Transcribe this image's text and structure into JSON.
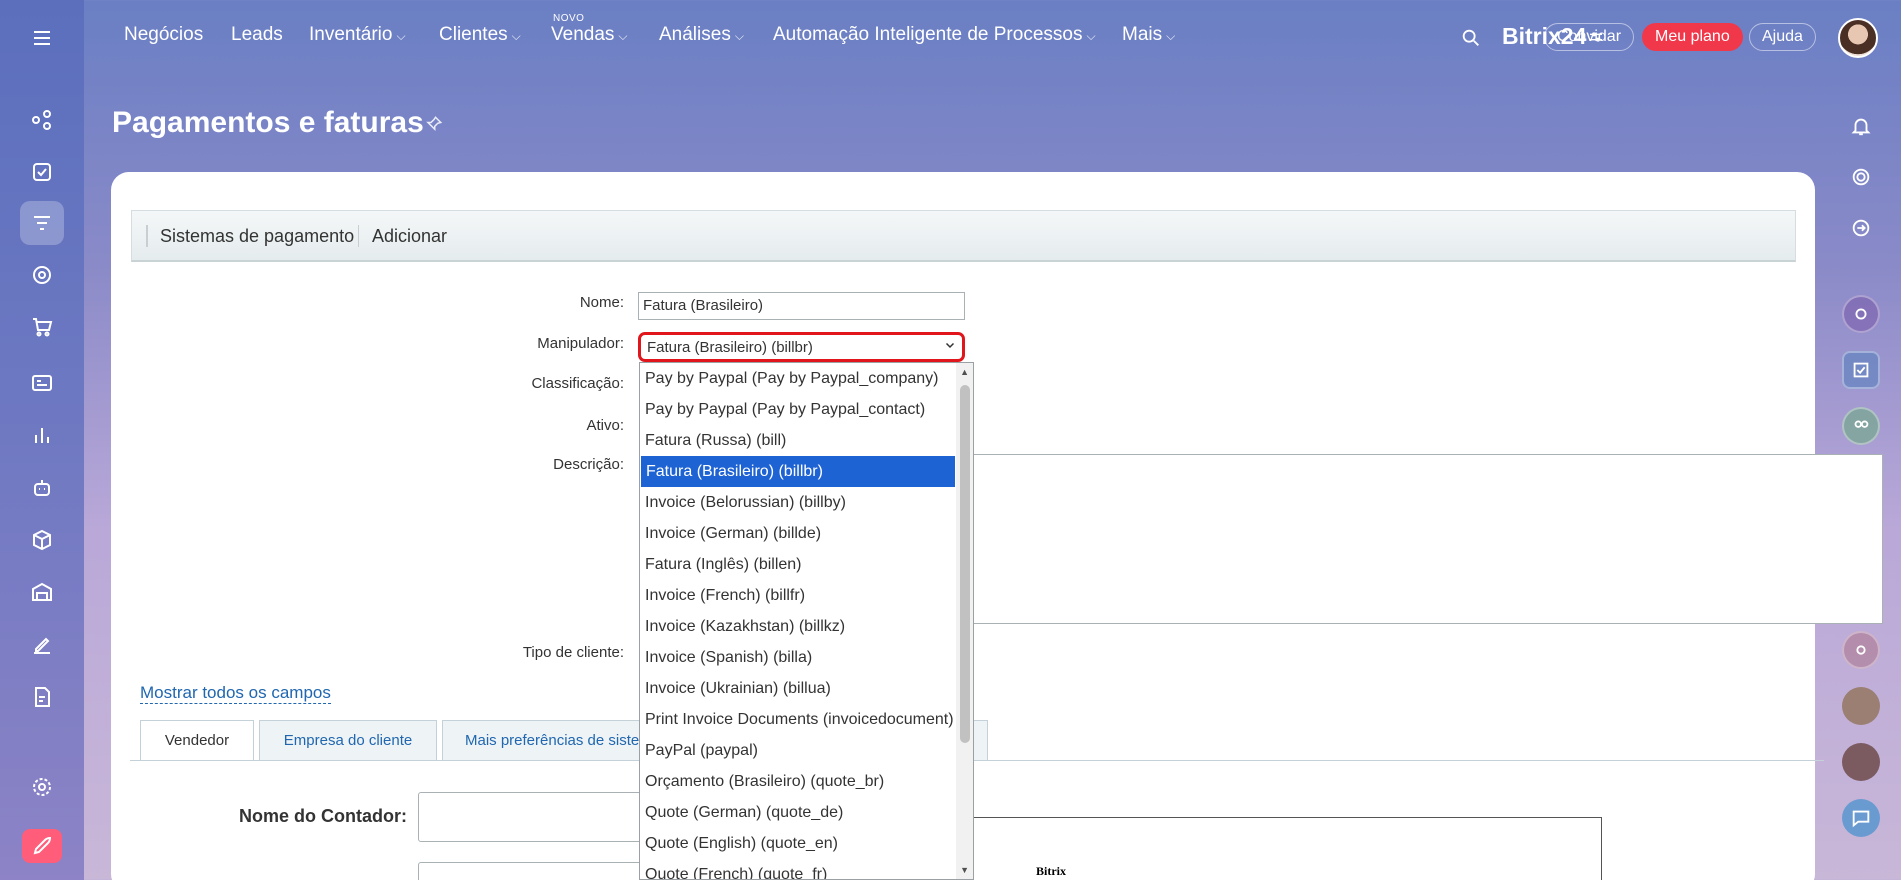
{
  "nav": {
    "items": [
      {
        "label": "Negócios",
        "chevron": false
      },
      {
        "label": "Leads",
        "chevron": false
      },
      {
        "label": "Inventário",
        "chevron": true
      },
      {
        "label": "Clientes",
        "chevron": true
      },
      {
        "label": "Vendas",
        "chevron": true
      },
      {
        "label": "Análises",
        "chevron": true
      },
      {
        "label": "Automação Inteligente de Processos",
        "chevron": true
      },
      {
        "label": "Mais",
        "chevron": true
      }
    ],
    "new_badge": "NOVO",
    "brand": "Bitrix24",
    "invite": "Convidar",
    "plan": "Meu plano",
    "help": "Ajuda",
    "chevron_glyph": "⌵"
  },
  "page": {
    "title": "Pagamentos e faturas"
  },
  "toolbar": {
    "systems": "Sistemas de pagamento",
    "add": "Adicionar"
  },
  "form": {
    "name_label": "Nome:",
    "name_value": "Fatura (Brasileiro)",
    "handler_label": "Manipulador:",
    "handler_value": "Fatura (Brasileiro) (billbr)",
    "sort_label": "Classificação:",
    "active_label": "Ativo:",
    "desc_label": "Descrição:",
    "client_type_label": "Tipo de cliente:",
    "show_all": "Mostrar todos os campos"
  },
  "tabs": [
    {
      "label": "Vendedor",
      "active": true
    },
    {
      "label": "Empresa do cliente",
      "active": false
    },
    {
      "label": "Mais preferências de siste",
      "active": false
    }
  ],
  "contador": {
    "label": "Nome do Contador:"
  },
  "preview": {
    "text": "Bitrix"
  },
  "dropdown": {
    "options": [
      "Pay by Paypal (Pay by Paypal_company)",
      "Pay by Paypal (Pay by Paypal_contact)",
      "Fatura (Russa) (bill)",
      "Fatura (Brasileiro) (billbr)",
      "Invoice (Belorussian) (billby)",
      "Invoice (German) (billde)",
      "Fatura (Inglês) (billen)",
      "Invoice (French) (billfr)",
      "Invoice (Kazakhstan) (billkz)",
      "Invoice (Spanish) (billa)",
      "Invoice (Ukrainian) (billua)",
      "Print Invoice Documents (invoicedocument)",
      "PayPal (paypal)",
      "Orçamento (Brasileiro) (quote_br)",
      "Quote (German) (quote_de)",
      "Quote (English) (quote_en)",
      "Quote (French) (quote_fr)"
    ],
    "selected_index": 3,
    "selected_color": "#1e63d4"
  },
  "colors": {
    "accent_red": "#f0384a",
    "highlight_red": "#e0161c",
    "link_blue": "#2067b0"
  }
}
